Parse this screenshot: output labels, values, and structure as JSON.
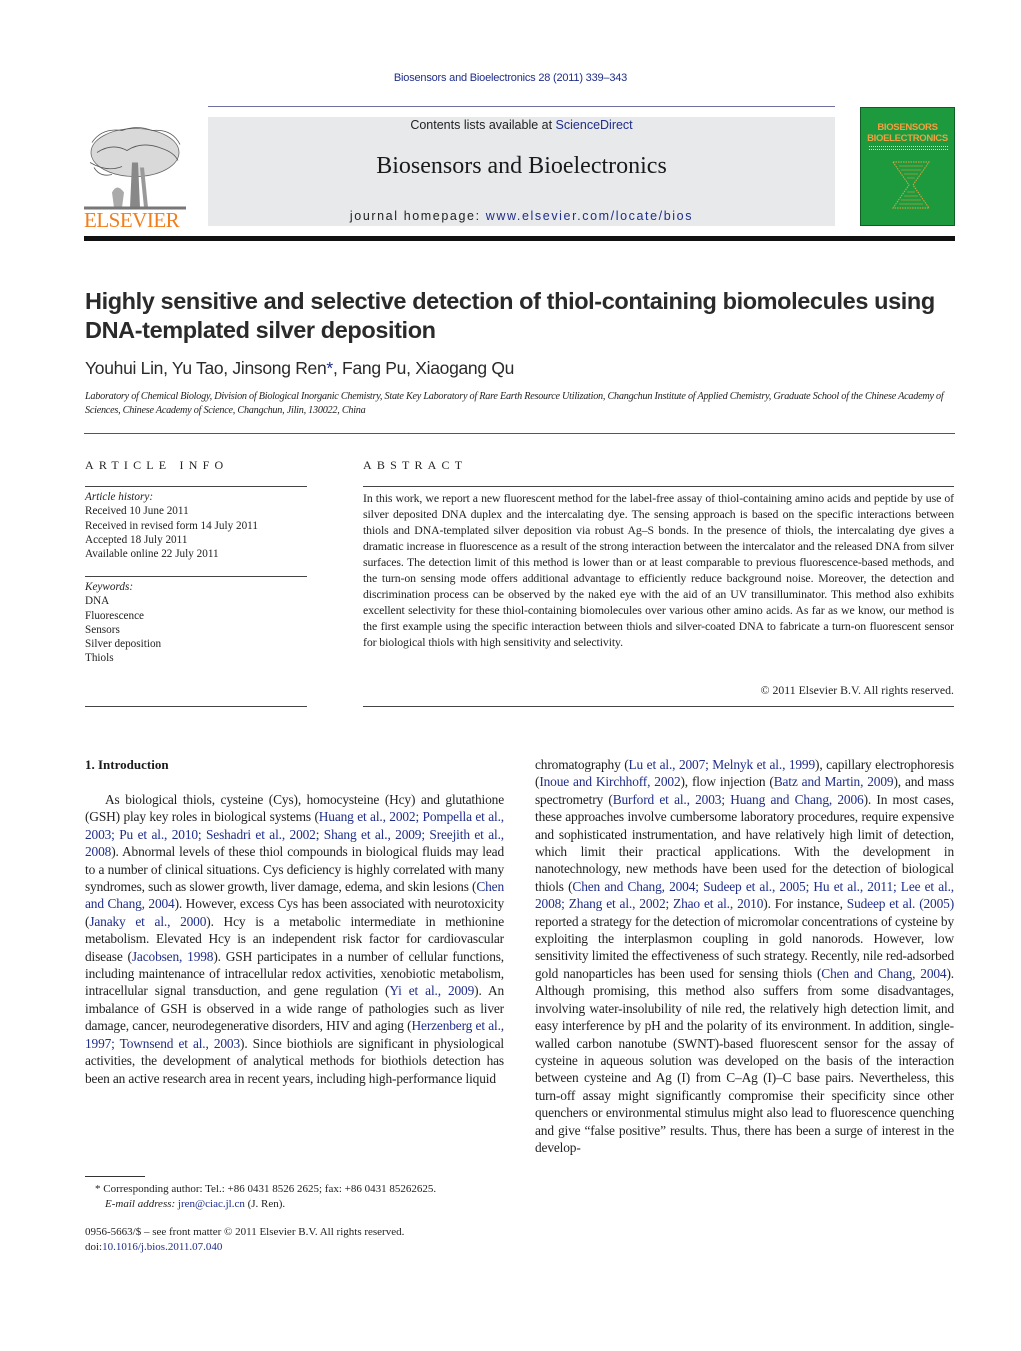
{
  "header": {
    "journal_ref": "Biosensors and Bioelectronics 28 (2011) 339–343",
    "publisher_logo_text": "ELSEVIER",
    "contents_prefix": "Contents lists available at ",
    "contents_link": "ScienceDirect",
    "journal_title": "Biosensors and Bioelectronics",
    "homepage_prefix": "journal homepage: ",
    "homepage_link": "www.elsevier.com/locate/bios",
    "cover_title_line1": "BIOSENSORS",
    "cover_title_line2": "BIOELECTRONICS",
    "colors": {
      "link": "#1f2e8a",
      "elsevier_orange": "#f07e1c",
      "cover_green": "#1e9a3e",
      "masthead_gray": "#e8e9eb"
    }
  },
  "article": {
    "title": "Highly sensitive and selective detection of thiol-containing biomolecules using DNA-templated silver deposition",
    "authors_before": "Youhui Lin, Yu Tao, Jinsong Ren",
    "corresponding_mark": "*",
    "authors_after": ", Fang Pu, Xiaogang Qu",
    "affiliation": "Laboratory of Chemical Biology, Division of Biological Inorganic Chemistry, State Key Laboratory of Rare Earth Resource Utilization, Changchun Institute of Applied Chemistry, Graduate School of the Chinese Academy of Sciences, Chinese Academy of Science, Changchun, Jilin, 130022, China"
  },
  "article_info": {
    "heading": "ARTICLE INFO",
    "history_label": "Article history:",
    "history": [
      "Received 10 June 2011",
      "Received in revised form 14 July 2011",
      "Accepted 18 July 2011",
      "Available online 22 July 2011"
    ],
    "keywords_label": "Keywords:",
    "keywords": [
      "DNA",
      "Fluorescence",
      "Sensors",
      "Silver deposition",
      "Thiols"
    ]
  },
  "abstract": {
    "heading": "ABSTRACT",
    "text": "In this work, we report a new fluorescent method for the label-free assay of thiol-containing amino acids and peptide by use of silver deposited DNA duplex and the intercalating dye. The sensing approach is based on the specific interactions between thiols and DNA-templated silver deposition via robust Ag–S bonds. In the presence of thiols, the intercalating dye gives a dramatic increase in fluorescence as a result of the strong interaction between the intercalator and the released DNA from silver surfaces. The detection limit of this method is lower than or at least comparable to previous fluorescence-based methods, and the turn-on sensing mode offers additional advantage to efficiently reduce background noise. Moreover, the detection and discrimination process can be observed by the naked eye with the aid of an UV transilluminator. This method also exhibits excellent selectivity for these thiol-containing biomolecules over various other amino acids. As far as we know, our method is the first example using the specific interaction between thiols and silver-coated DNA to fabricate a turn-on fluorescent sensor for biological thiols with high sensitivity and selectivity.",
    "copyright": "© 2011 Elsevier B.V. All rights reserved."
  },
  "introduction": {
    "heading": "1.  Introduction",
    "left_column": [
      {
        "t": "As biological thiols, cysteine (Cys), homocysteine (Hcy) and glutathione (GSH) play key roles in biological systems ("
      },
      {
        "t": "Huang et al., 2002; Pompella et al., 2003; Pu et al., 2010; Seshadri et al., 2002; Shang et al., 2009; Sreejith et al., 2008",
        "link": true
      },
      {
        "t": "). Abnormal levels of these thiol compounds in biological fluids may lead to a number of clinical situations. Cys deficiency is highly correlated with many syndromes, such as slower growth, liver damage, edema, and skin lesions ("
      },
      {
        "t": "Chen and Chang, 2004",
        "link": true
      },
      {
        "t": "). However, excess Cys has been associated with neurotoxicity ("
      },
      {
        "t": "Janaky et al., 2000",
        "link": true
      },
      {
        "t": "). Hcy is a metabolic intermediate in methionine metabolism. Elevated Hcy is an independent risk factor for cardiovascular disease ("
      },
      {
        "t": "Jacobsen, 1998",
        "link": true
      },
      {
        "t": "). GSH participates in a number of cellular functions, including maintenance of intracellular redox activities, xenobiotic metabolism, intracellular signal transduction, and gene regulation ("
      },
      {
        "t": "Yi et al., 2009",
        "link": true
      },
      {
        "t": "). An imbalance of GSH is observed in a wide range of pathologies such as liver damage, cancer, neurodegenerative disorders, HIV and aging ("
      },
      {
        "t": "Herzenberg et al., 1997; Townsend et al., 2003",
        "link": true
      },
      {
        "t": "). Since biothiols are significant in physiological activities, the development of analytical methods for biothiols detection has been an active research area in recent years, including high-performance liquid"
      }
    ],
    "right_column": [
      {
        "t": "chromatography ("
      },
      {
        "t": "Lu et al., 2007; Melnyk et al., 1999",
        "link": true
      },
      {
        "t": "), capillary electrophoresis ("
      },
      {
        "t": "Inoue and Kirchhoff, 2002",
        "link": true
      },
      {
        "t": "), flow injection ("
      },
      {
        "t": "Batz and Martin, 2009",
        "link": true
      },
      {
        "t": "), and mass spectrometry ("
      },
      {
        "t": "Burford et al., 2003; Huang and Chang, 2006",
        "link": true
      },
      {
        "t": "). In most cases, these approaches involve cumbersome laboratory procedures, require expensive and sophisticated instrumentation, and have relatively high limit of detection, which limit their practical applications. With the development in nanotechnology, new methods have been used for the detection of biological thiols ("
      },
      {
        "t": "Chen and Chang, 2004; Sudeep et al., 2005; Hu et al., 2011; Lee et al., 2008; Zhang et al., 2002; Zhao et al., 2010",
        "link": true
      },
      {
        "t": "). For instance, "
      },
      {
        "t": "Sudeep et al. (2005)",
        "link": true
      },
      {
        "t": " reported a strategy for the detection of micromolar concentrations of cysteine by exploiting the interplasmon coupling in gold nanorods. However, low sensitivity limited the effectiveness of such strategy. Recently, nile red-adsorbed gold nanoparticles has been used for sensing thiols ("
      },
      {
        "t": "Chen and Chang, 2004",
        "link": true
      },
      {
        "t": "). Although promising, this method also suffers from some disadvantages, involving water-insolubility of nile red, the relatively high detection limit, and easy interference by pH and the polarity of its environment. In addition, single-walled carbon nanotube (SWNT)-based fluorescent sensor for the assay of cysteine in aqueous solution was developed on the basis of the interaction between cysteine and Ag (I) from C–Ag (I)–C base pairs. Nevertheless, this turn-off assay might significantly compromise their specificity since other quenchers or environmental stimulus might also lead to fluorescence quenching and give “false positive” results. Thus, there has been a surge of interest in the develop-"
      }
    ]
  },
  "footnote": {
    "mark": "*",
    "text": " Corresponding author: Tel.: +86 0431 8526 2625; fax: +86 0431 85262625.",
    "email_label": "E-mail address: ",
    "email": "jren@ciac.jl.cn",
    "email_suffix": " (J. Ren)."
  },
  "frontmatter": {
    "issn_line": "0956-5663/$ – see front matter © 2011 Elsevier B.V. All rights reserved.",
    "doi_prefix": "doi:",
    "doi": "10.1016/j.bios.2011.07.040"
  }
}
